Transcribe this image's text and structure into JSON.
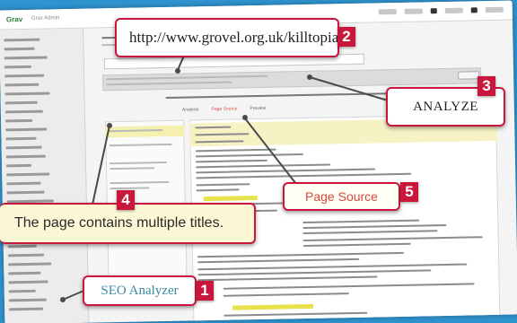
{
  "app": {
    "logo": "Grav",
    "logo_sub": "Grav Admin"
  },
  "callouts": [
    {
      "number": "1",
      "text": "SEO Analyzer"
    },
    {
      "number": "2",
      "text": "http://www.grovel.org.uk/killtopia"
    },
    {
      "number": "3",
      "text": "ANALYZE"
    },
    {
      "number": "4",
      "text": "The page contains multiple titles."
    },
    {
      "number": "5",
      "text": "Page Source"
    }
  ],
  "tabs": [
    "Analysis",
    "Page Source",
    "Preview"
  ],
  "colors": {
    "background": "#2f93cf",
    "callout_border": "#c9163d",
    "badge": "#c9163d",
    "page_source_text": "#d34a3c",
    "seo_text": "#3a8aa0",
    "highlight": "#f7f2c4"
  }
}
